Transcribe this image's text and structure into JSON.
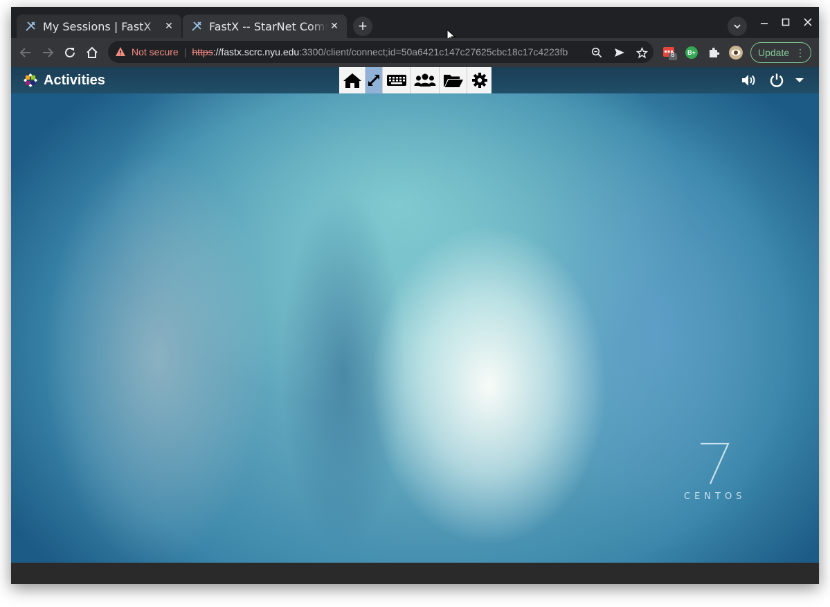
{
  "browser": {
    "tabs": [
      {
        "title": "My Sessions | FastX",
        "active": false,
        "favicon": "fastx-icon"
      },
      {
        "title": "FastX -- StarNet Communications",
        "active": true,
        "favicon": "fastx-icon"
      }
    ],
    "new_tab_label": "+",
    "omnibox": {
      "security_label": "Not secure",
      "url_scheme": "https",
      "url_host": "://fastx.scrc.nyu.edu",
      "url_rest": ":3300/client/connect;id=50a6421c147c27625cbc18c17c4223fb"
    },
    "extensions": [
      {
        "name": "calendar-extension-icon",
        "badge": "8"
      },
      {
        "name": "b-plus-extension-icon",
        "label": "B+"
      },
      {
        "name": "puzzle-icon"
      },
      {
        "name": "profile-avatar"
      }
    ],
    "update_label": "Update"
  },
  "desktop": {
    "activities_label": "Activities",
    "fastx_toolbar": [
      "home-icon",
      "fullscreen-icon",
      "keyboard-icon",
      "users-icon",
      "folder-icon",
      "gear-icon"
    ],
    "watermark": {
      "number": "7",
      "text": "CENTOS"
    }
  },
  "colors": {
    "tab_bg": "#202124",
    "toolbar_bg": "#35363a",
    "not_secure": "#f28b82",
    "update_green": "#81c995",
    "fastx_active": "#8fb2d6"
  }
}
